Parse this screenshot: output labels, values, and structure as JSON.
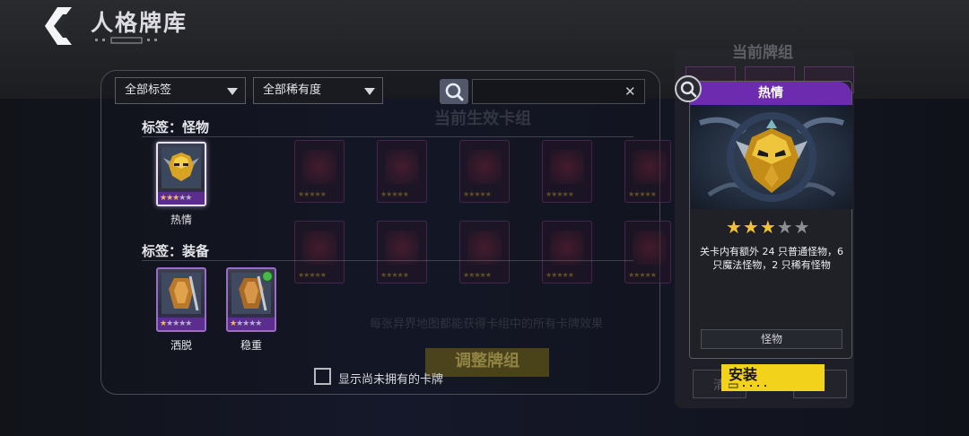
{
  "header": {
    "title": "人格牌库"
  },
  "filters": {
    "tag_dropdown": "全部标签",
    "rarity_dropdown": "全部稀有度",
    "search_value": ""
  },
  "background": {
    "active_deck_title": "当前生效卡组",
    "active_deck_desc": "每张异界地图都能获得卡组中的所有卡牌效果",
    "adjust_button": "调整牌组",
    "deck_title": "当前牌组",
    "side_button": "清"
  },
  "sections": [
    {
      "label": "标签：怪物",
      "cards": [
        {
          "name": "热情",
          "stars": 3,
          "max_stars": 5,
          "selected": true,
          "new": false
        }
      ]
    },
    {
      "label": "标签：装备",
      "cards": [
        {
          "name": "洒脱",
          "stars": 1,
          "max_stars": 5,
          "selected": false,
          "new": false
        },
        {
          "name": "稳重",
          "stars": 1,
          "max_stars": 5,
          "selected": false,
          "new": true
        }
      ]
    }
  ],
  "show_unowned": {
    "label": "显示尚未拥有的卡牌",
    "checked": false
  },
  "detail": {
    "name": "热情",
    "stars": 3,
    "max_stars": 5,
    "description": "关卡内有额外 24 只普通怪物，6 只魔法怪物，2 只稀有怪物",
    "tag": "怪物",
    "install_label": "安装"
  },
  "colors": {
    "accent_purple": "#6d2bb0",
    "install_yellow": "#f2d21b",
    "star_gold": "#f1c232"
  },
  "icons": [
    "back-chevron-icon",
    "search-icon",
    "clear-x-icon",
    "magnify-icon",
    "mask-art-icon",
    "armor-art-icon"
  ]
}
